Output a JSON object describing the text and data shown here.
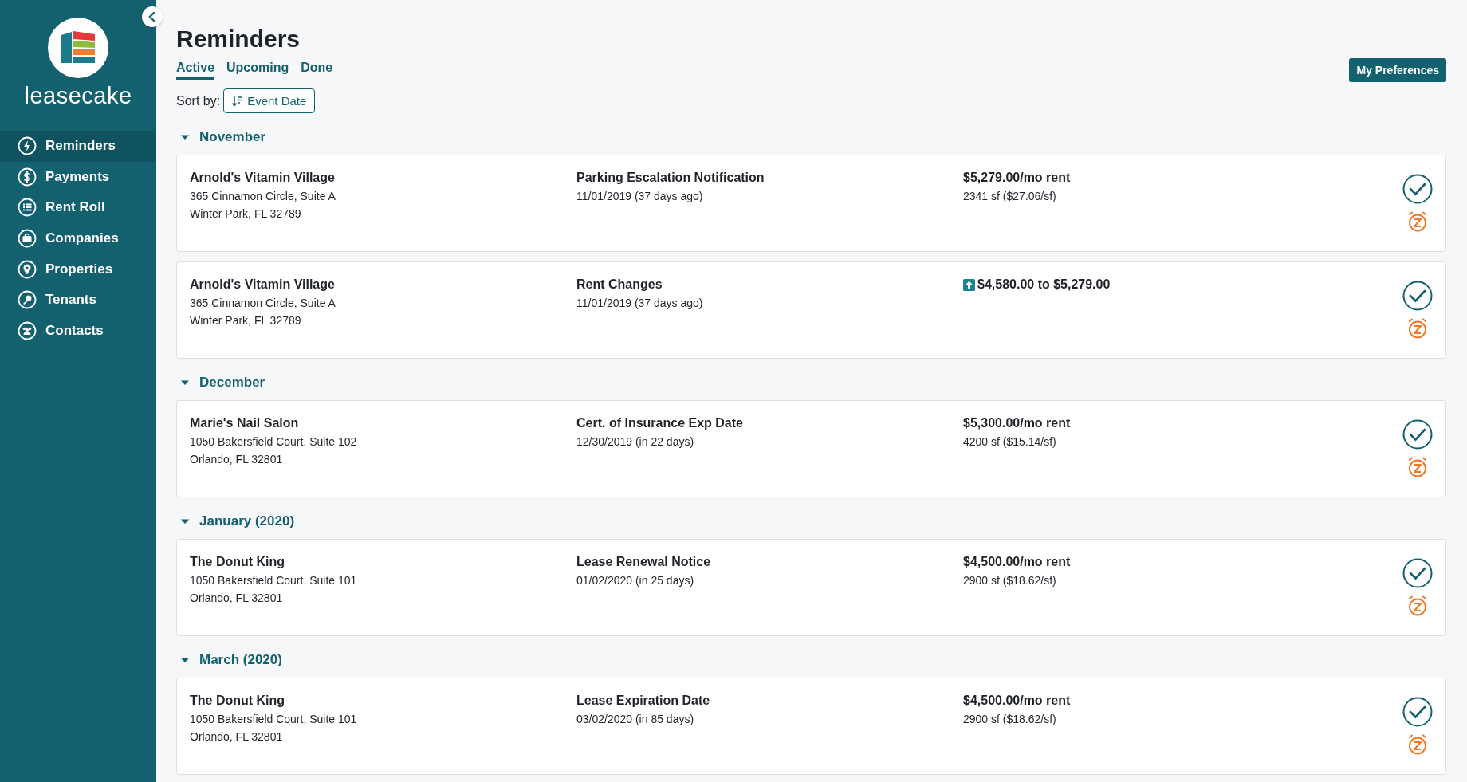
{
  "sidebar": {
    "logo_text": "leasecake",
    "items": [
      {
        "label": "Reminders",
        "selected": true
      },
      {
        "label": "Payments",
        "selected": false
      },
      {
        "label": "Rent Roll",
        "selected": false
      },
      {
        "label": "Companies",
        "selected": false
      },
      {
        "label": "Properties",
        "selected": false
      },
      {
        "label": "Tenants",
        "selected": false
      },
      {
        "label": "Contacts",
        "selected": false
      }
    ]
  },
  "page": {
    "title": "Reminders",
    "preferences_button": "My Preferences",
    "tabs": [
      {
        "label": "Active",
        "selected": true
      },
      {
        "label": "Upcoming",
        "selected": false
      },
      {
        "label": "Done",
        "selected": false
      }
    ],
    "sort": {
      "label": "Sort by:",
      "value": "Event Date"
    }
  },
  "groups": [
    {
      "label": "November",
      "expanded": true,
      "reminders": [
        {
          "tenant": "Arnold's Vitamin Village",
          "address": "365 Cinnamon Circle, Suite A",
          "city": "Winter Park, FL 32789",
          "event": "Parking Escalation Notification",
          "date": "11/01/2019 (37 days ago)",
          "kind": "rent",
          "amount": "$5,279.00/mo rent",
          "detail": "2341 sf ($27.06/sf)"
        },
        {
          "tenant": "Arnold's Vitamin Village",
          "address": "365 Cinnamon Circle, Suite A",
          "city": "Winter Park, FL 32789",
          "event": "Rent Changes",
          "date": "11/01/2019 (37 days ago)",
          "kind": "change",
          "amount": "$4,580.00 to $5,279.00"
        }
      ]
    },
    {
      "label": "December",
      "expanded": true,
      "reminders": [
        {
          "tenant": "Marie's Nail Salon",
          "address": "1050 Bakersfield Court, Suite 102",
          "city": "Orlando, FL 32801",
          "event": "Cert. of Insurance Exp Date",
          "date": "12/30/2019 (in 22 days)",
          "kind": "rent",
          "amount": "$5,300.00/mo rent",
          "detail": "4200 sf ($15.14/sf)"
        }
      ]
    },
    {
      "label": "January (2020)",
      "expanded": true,
      "reminders": [
        {
          "tenant": "The Donut King",
          "address": "1050 Bakersfield Court, Suite 101",
          "city": "Orlando, FL 32801",
          "event": "Lease Renewal Notice",
          "date": "01/02/2020 (in 25 days)",
          "kind": "rent",
          "amount": "$4,500.00/mo rent",
          "detail": "2900 sf ($18.62/sf)"
        }
      ]
    },
    {
      "label": "March (2020)",
      "expanded": true,
      "reminders": [
        {
          "tenant": "The Donut King",
          "address": "1050 Bakersfield Court, Suite 101",
          "city": "Orlando, FL 32801",
          "event": "Lease Expiration Date",
          "date": "03/02/2020 (in 85 days)",
          "kind": "rent",
          "amount": "$4,500.00/mo rent",
          "detail": "2900 sf ($18.62/sf)"
        }
      ]
    }
  ]
}
